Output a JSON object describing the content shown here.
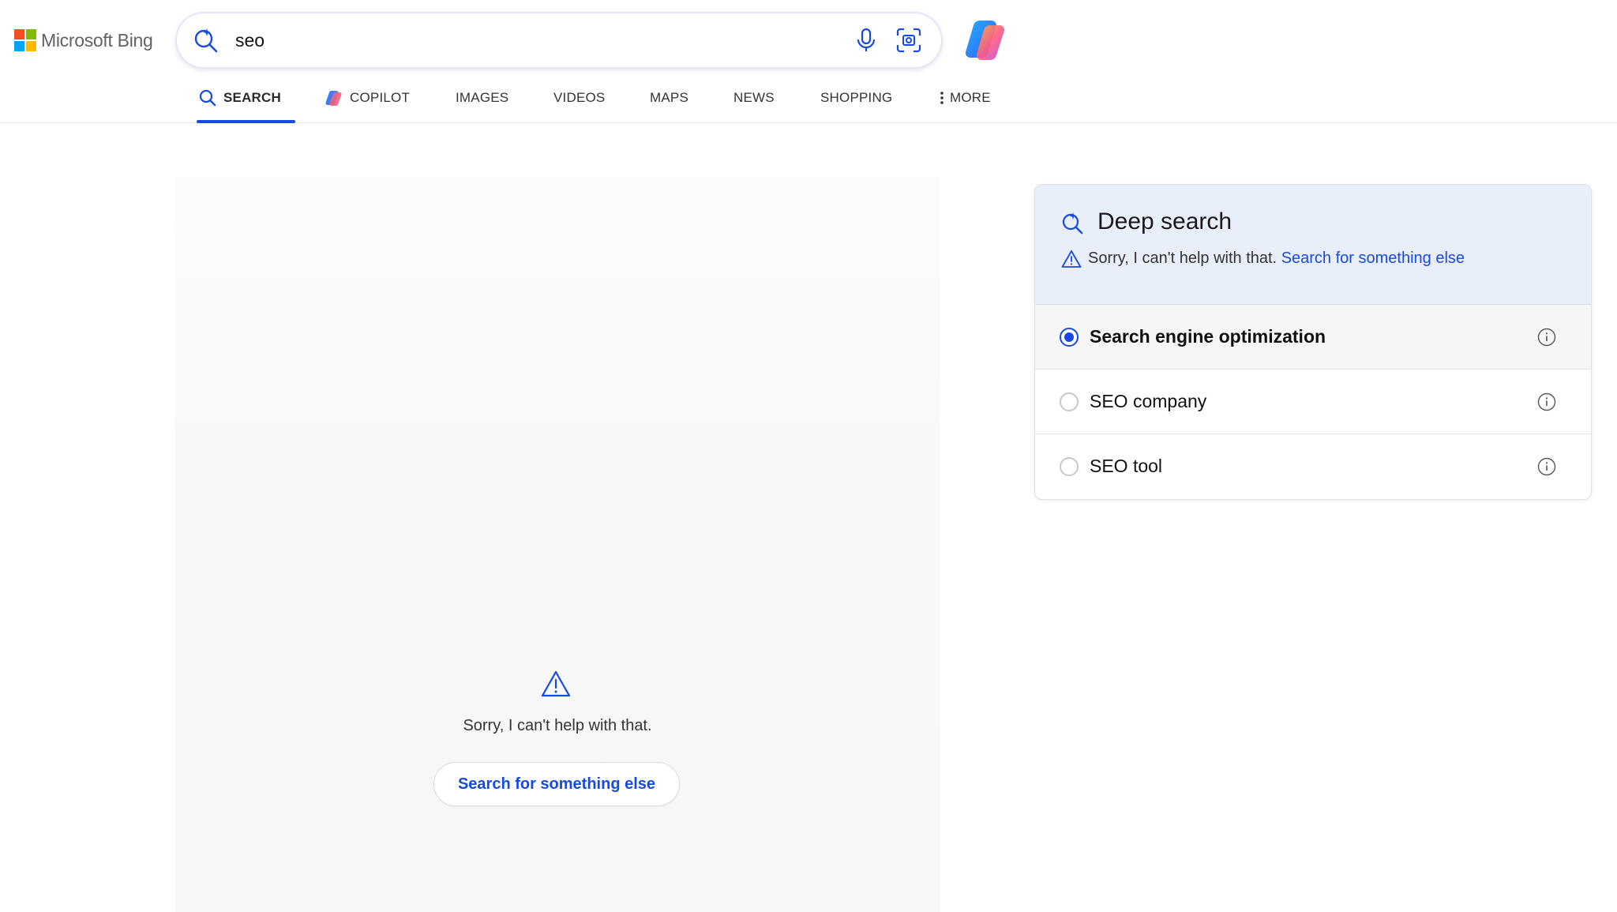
{
  "brand": {
    "name": "Microsoft Bing",
    "logo_colors": [
      "#f25022",
      "#7fba00",
      "#00a4ef",
      "#ffb900"
    ],
    "accent": "#174ae4"
  },
  "search": {
    "query": "seo",
    "icons": [
      "search-sparkle-icon",
      "microphone-icon",
      "visual-search-icon",
      "copilot-icon"
    ]
  },
  "tabs": [
    {
      "label": "SEARCH",
      "icon": "search-icon",
      "active": true
    },
    {
      "label": "COPILOT",
      "icon": "copilot-icon",
      "active": false
    },
    {
      "label": "IMAGES",
      "active": false
    },
    {
      "label": "VIDEOS",
      "active": false
    },
    {
      "label": "MAPS",
      "active": false
    },
    {
      "label": "NEWS",
      "active": false
    },
    {
      "label": "SHOPPING",
      "active": false
    },
    {
      "label": "MORE",
      "icon": "more-vertical-icon",
      "active": false
    }
  ],
  "main": {
    "error_text": "Sorry, I can't help with that.",
    "button_label": "Search for something else"
  },
  "deep_search": {
    "title": "Deep search",
    "message": "Sorry, I can't help with that.",
    "link": "Search for something else",
    "options": [
      {
        "label": "Search engine optimization",
        "selected": true
      },
      {
        "label": "SEO company",
        "selected": false
      },
      {
        "label": "SEO tool",
        "selected": false
      }
    ]
  }
}
